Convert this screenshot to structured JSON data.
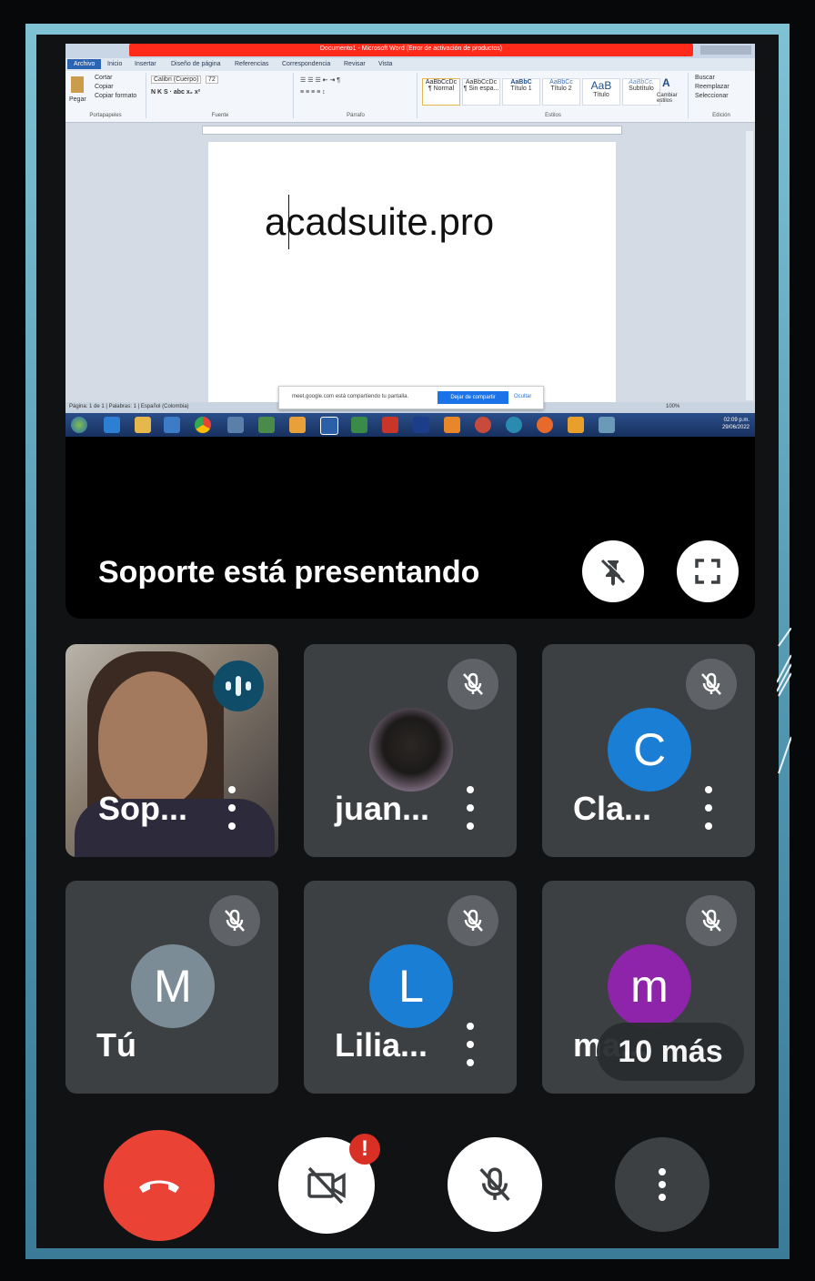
{
  "word": {
    "title": "Documento1 - Microsoft Word (Error de activación de productos)",
    "tabs": [
      "Archivo",
      "Inicio",
      "Insertar",
      "Diseño de página",
      "Referencias",
      "Correspondencia",
      "Revisar",
      "Vista"
    ],
    "clipboard": [
      "Cortar",
      "Copiar",
      "Copiar formato"
    ],
    "paste_label": "Pegar",
    "font_name": "Calibri (Cuerpo)",
    "font_size": "72",
    "groups": [
      "Portapapeles",
      "Fuente",
      "Párrafo",
      "Estilos",
      "Edición"
    ],
    "styles": [
      {
        "sample": "AaBbCcDc",
        "name": "¶ Normal"
      },
      {
        "sample": "AaBbCcDc",
        "name": "¶ Sin espa..."
      },
      {
        "sample": "AaBbC",
        "name": "Título 1"
      },
      {
        "sample": "AaBbCc",
        "name": "Título 2"
      },
      {
        "sample": "AaB",
        "name": "Título"
      },
      {
        "sample": "AaBbCc.",
        "name": "Subtítulo"
      }
    ],
    "change_styles": "Cambiar estilos",
    "editing": [
      "Buscar",
      "Reemplazar",
      "Seleccionar"
    ],
    "document_text": "acadsuite.pro",
    "status": "Página: 1 de 1 | Palabras: 1 | Español (Colombia)",
    "zoom": "100%",
    "share_banner": {
      "message": "meet.google.com está compartiendo tu pantalla.",
      "stop": "Dejar de compartir",
      "hide": "Ocultar"
    },
    "clock_time": "02:09 p.m.",
    "clock_date": "29/06/2022"
  },
  "presentation": {
    "text": "Soporte está presentando"
  },
  "participants": [
    {
      "name": "Sop...",
      "type": "video",
      "speaking": true
    },
    {
      "name": "juan...",
      "type": "photo",
      "muted": true
    },
    {
      "name": "Cla...",
      "initial": "C",
      "color": "#1a7fd4",
      "muted": true
    },
    {
      "name": "Tú",
      "initial": "M",
      "color": "#7b8c96",
      "muted": true
    },
    {
      "name": "Lilia...",
      "initial": "L",
      "color": "#1a7fd4",
      "muted": true
    },
    {
      "name": "ma...",
      "initial": "m",
      "color": "#8e24aa",
      "muted": true
    }
  ],
  "more_participants": "10 más",
  "controls": {
    "end_call_color": "#ea4335",
    "camera_alert": "!"
  }
}
